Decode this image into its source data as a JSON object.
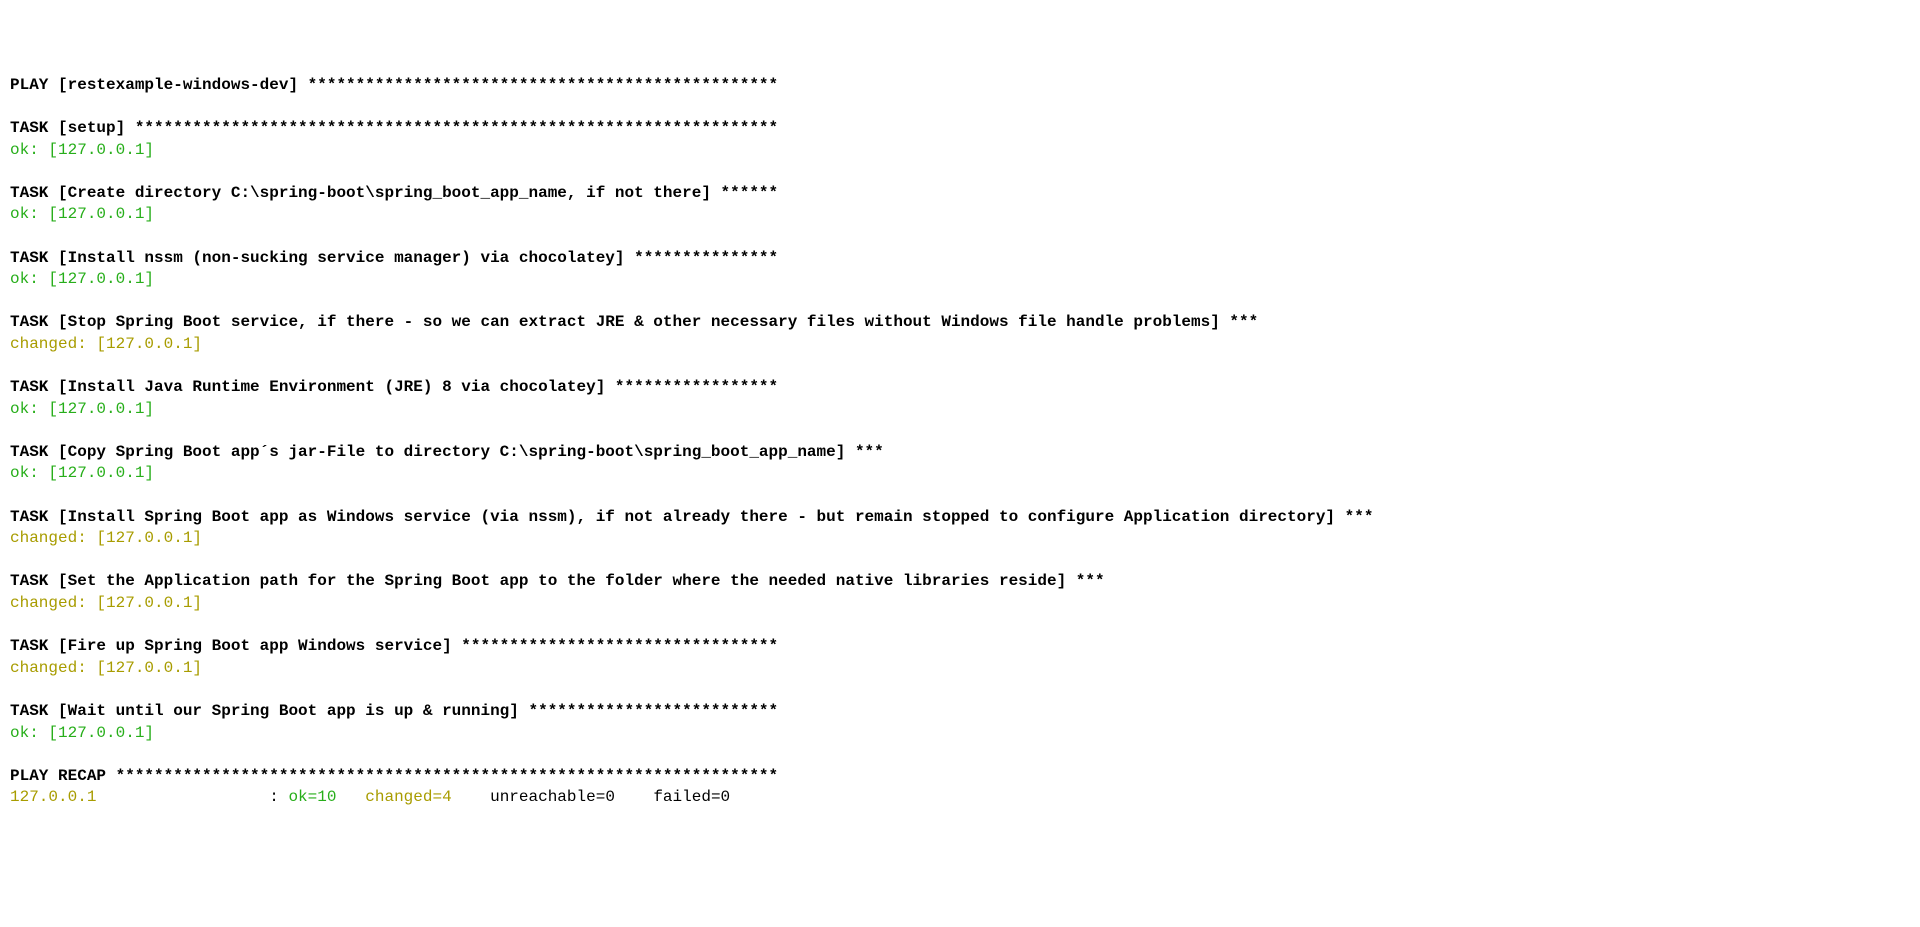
{
  "play_header": "PLAY [restexample-windows-dev] *************************************************",
  "tasks": [
    {
      "header": "TASK [setup] *******************************************************************",
      "status": "ok: [127.0.0.1]",
      "status_class": "green"
    },
    {
      "header": "TASK [Create directory C:\\spring-boot\\spring_boot_app_name, if not there] ******",
      "status": "ok: [127.0.0.1]",
      "status_class": "green"
    },
    {
      "header": "TASK [Install nssm (non-sucking service manager) via chocolatey] ***************",
      "status": "ok: [127.0.0.1]",
      "status_class": "green"
    },
    {
      "header": "TASK [Stop Spring Boot service, if there - so we can extract JRE & other necessary files without Windows file handle problems] ***",
      "status": "changed: [127.0.0.1]",
      "status_class": "olive"
    },
    {
      "header": "TASK [Install Java Runtime Environment (JRE) 8 via chocolatey] *****************",
      "status": "ok: [127.0.0.1]",
      "status_class": "green"
    },
    {
      "header": "TASK [Copy Spring Boot app´s jar-File to directory C:\\spring-boot\\spring_boot_app_name] ***",
      "status": "ok: [127.0.0.1]",
      "status_class": "green"
    },
    {
      "header": "TASK [Install Spring Boot app as Windows service (via nssm), if not already there - but remain stopped to configure Application directory] ***",
      "status": "changed: [127.0.0.1]",
      "status_class": "olive"
    },
    {
      "header": "TASK [Set the Application path for the Spring Boot app to the folder where the needed native libraries reside] ***",
      "status": "changed: [127.0.0.1]",
      "status_class": "olive"
    },
    {
      "header": "TASK [Fire up Spring Boot app Windows service] *********************************",
      "status": "changed: [127.0.0.1]",
      "status_class": "olive"
    },
    {
      "header": "TASK [Wait until our Spring Boot app is up & running] **************************",
      "status": "ok: [127.0.0.1]",
      "status_class": "green"
    }
  ],
  "recap_header": "PLAY RECAP *********************************************************************",
  "recap_host": "127.0.0.1",
  "recap_colon": "                  : ",
  "recap_ok": "ok=10   ",
  "recap_changed": "changed=4    ",
  "recap_unreachable": "unreachable=0    ",
  "recap_failed": "failed=0"
}
